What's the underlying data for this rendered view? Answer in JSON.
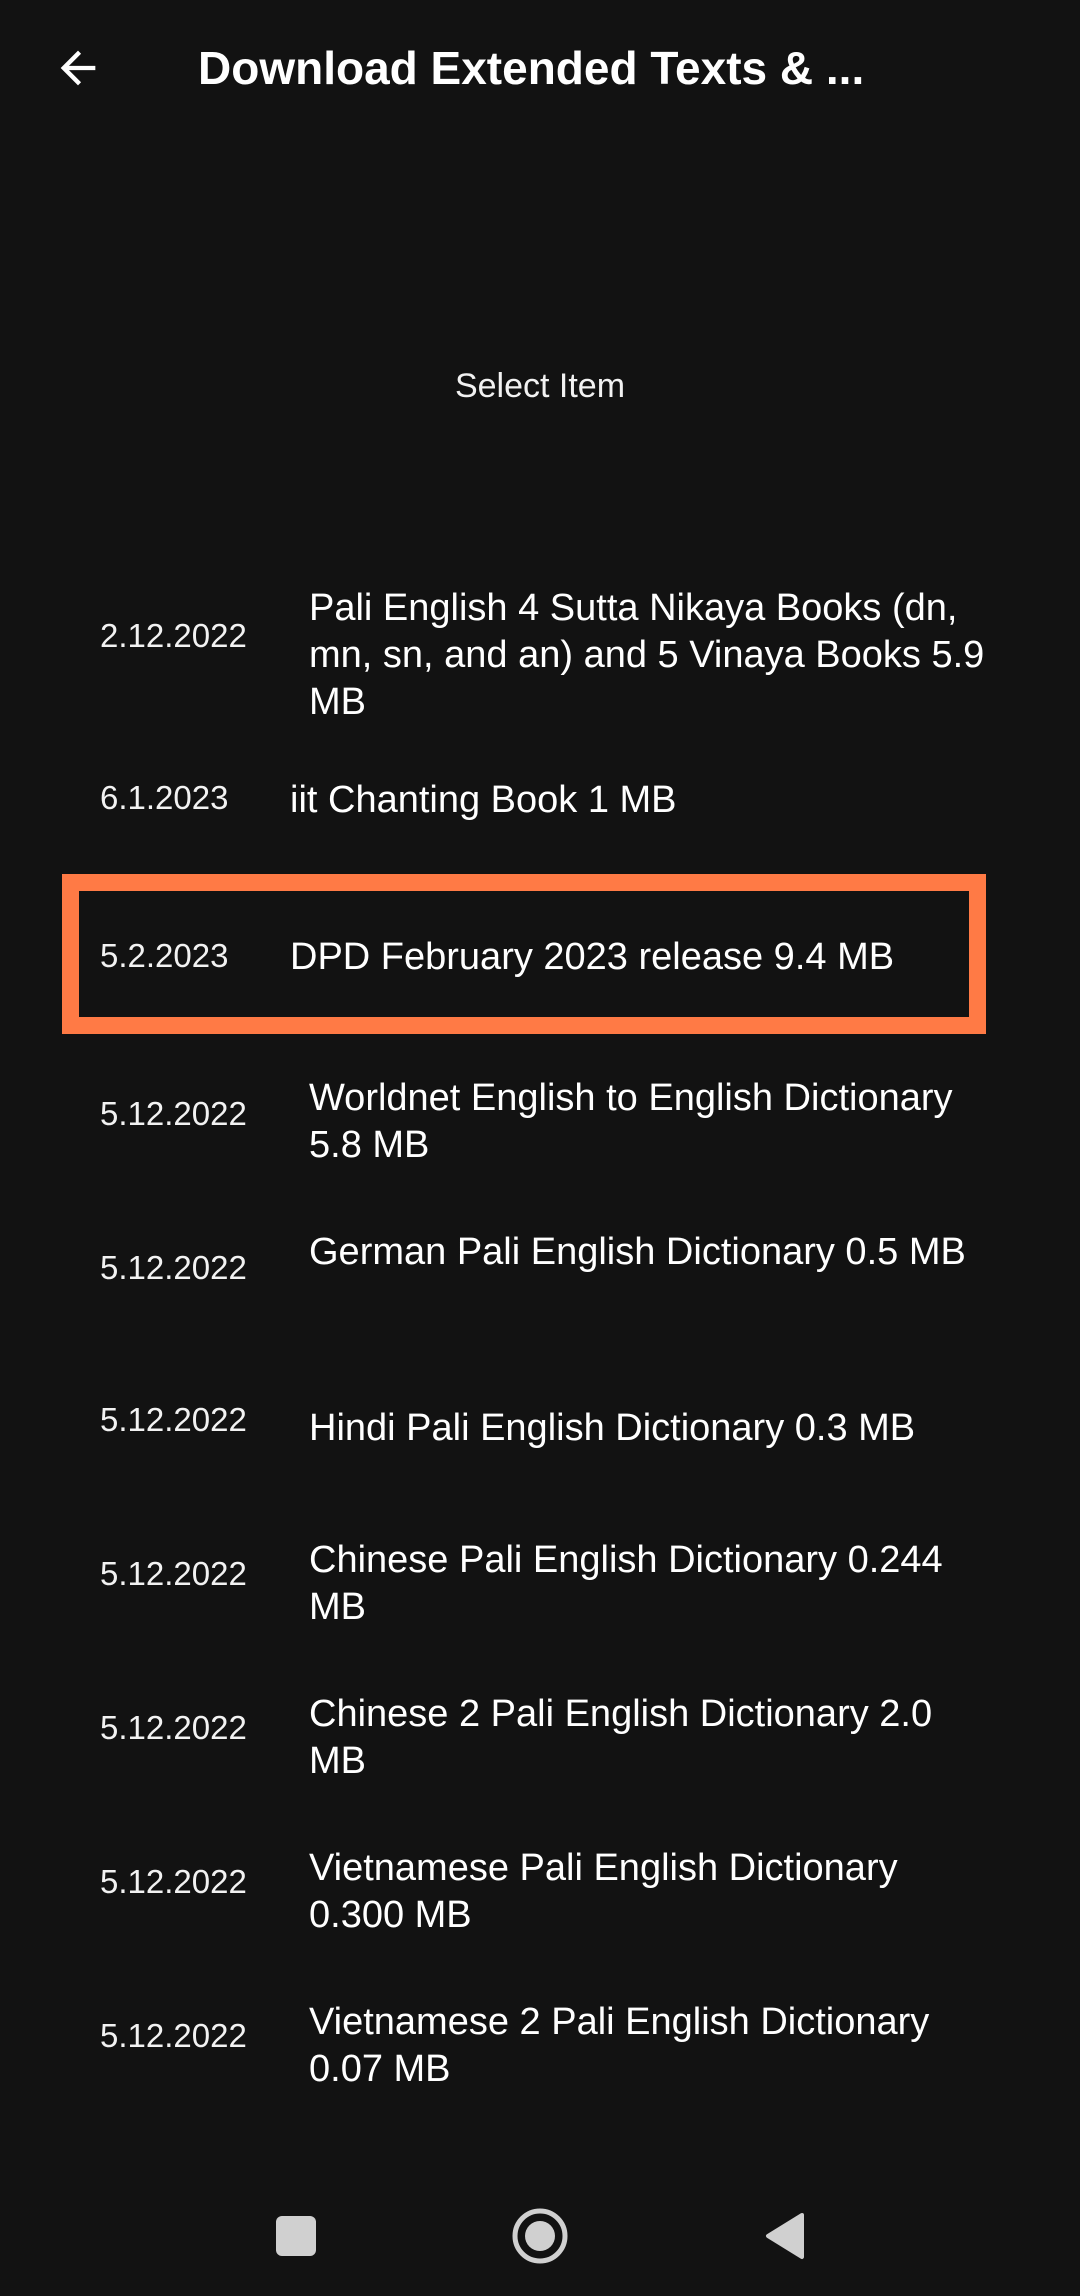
{
  "app_bar": {
    "title": "Download Extended Texts & ...",
    "back_icon": "arrow-left-icon"
  },
  "heading": "Select Item",
  "items": [
    {
      "date": "2.12.2022",
      "label": "Pali English 4 Sutta Nikaya Books (dn, mn, sn, and an) and 5 Vinaya Books 5.9 MB"
    },
    {
      "date": "6.1.2023",
      "label": "iit Chanting Book 1 MB"
    },
    {
      "date": "5.2.2023",
      "label": "DPD February 2023 release 9.4 MB",
      "highlighted": true
    },
    {
      "date": "5.12.2022",
      "label": "Worldnet English to English Dictionary 5.8 MB"
    },
    {
      "date": "5.12.2022",
      "label": "German Pali English Dictionary 0.5 MB"
    },
    {
      "date": "5.12.2022",
      "label": "Hindi Pali English Dictionary 0.3 MB"
    },
    {
      "date": "5.12.2022",
      "label": "Chinese Pali English Dictionary 0.244 MB"
    },
    {
      "date": "5.12.2022",
      "label": "Chinese 2 Pali English Dictionary 2.0 MB"
    },
    {
      "date": "5.12.2022",
      "label": "Vietnamese Pali English Dictionary 0.300 MB"
    },
    {
      "date": "5.12.2022",
      "label": "Vietnamese 2 Pali English Dictionary 0.07 MB"
    }
  ],
  "nav_bar": {
    "recents_icon": "square-icon",
    "home_icon": "circle-home-icon",
    "back_icon": "triangle-back-icon"
  },
  "colors": {
    "background": "#121212",
    "text": "#ffffff",
    "highlight": "#ff7a45",
    "nav_icon": "#d0d0d0"
  }
}
